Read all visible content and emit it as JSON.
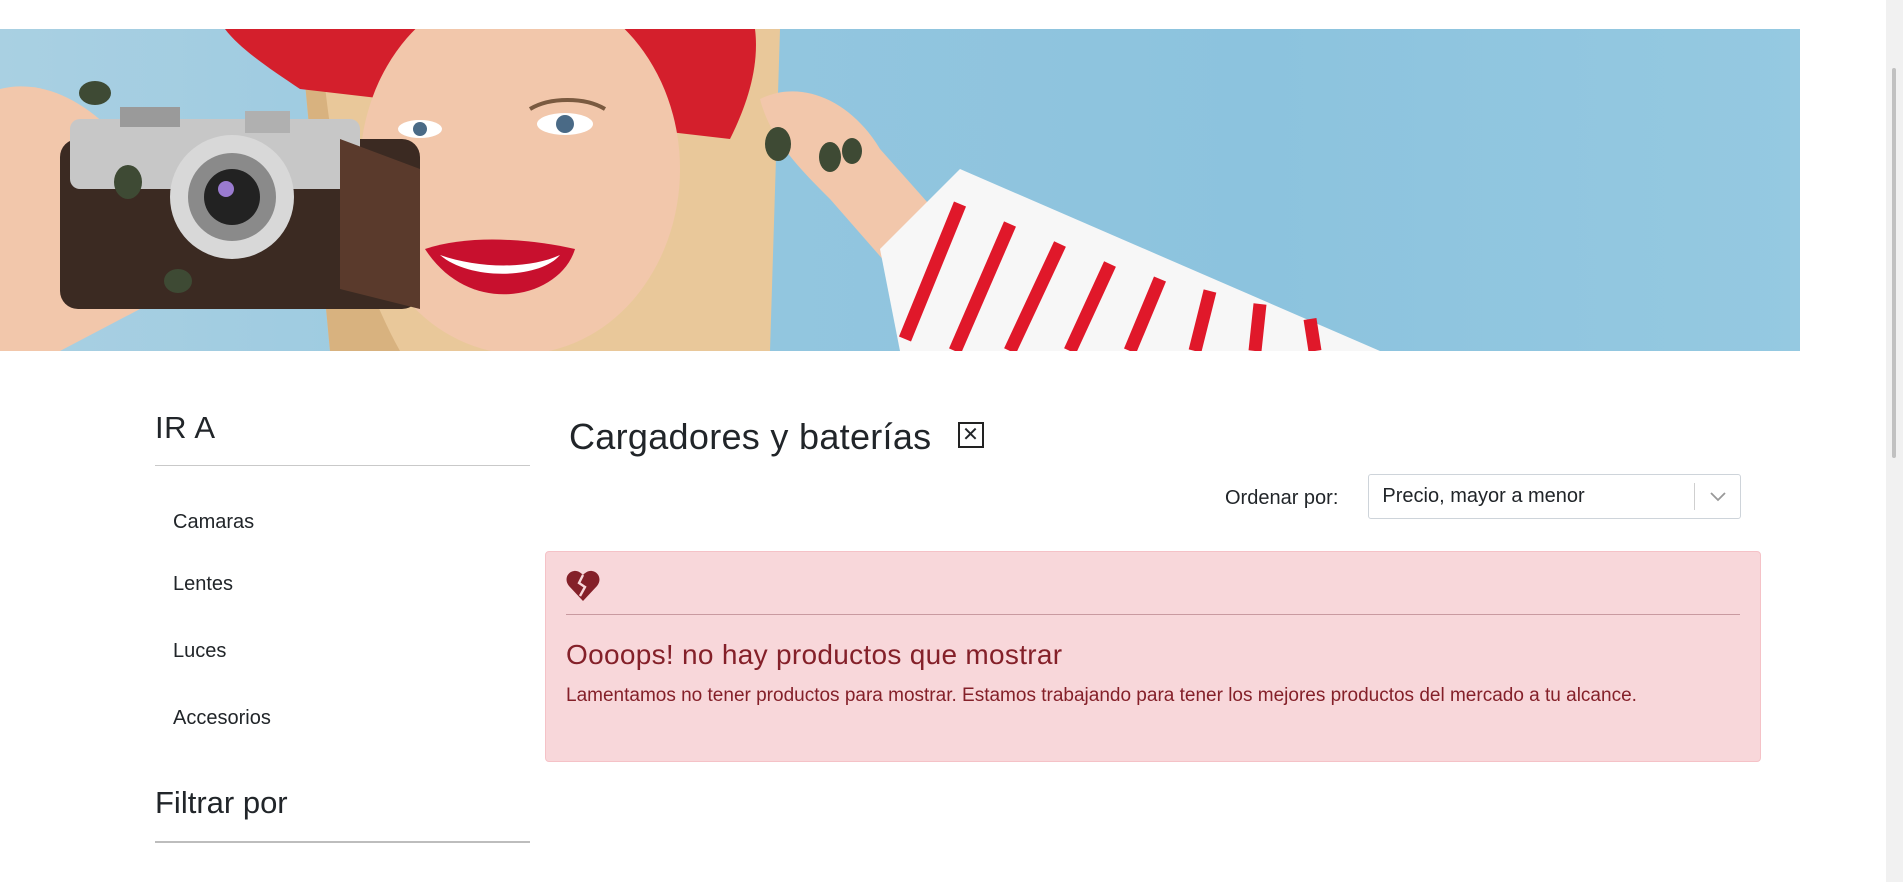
{
  "hero": {
    "alt": "banner-photo"
  },
  "sidebar": {
    "title": "IR A",
    "items": [
      {
        "label": "Camaras"
      },
      {
        "label": "Lentes"
      },
      {
        "label": "Luces"
      },
      {
        "label": "Accesorios"
      }
    ],
    "filter_title": "Filtrar por"
  },
  "main": {
    "title": "Cargadores y baterías",
    "clear_icon": "close-box-icon",
    "sort": {
      "label": "Ordenar por:",
      "selected": "Precio, mayor a menor"
    },
    "alert": {
      "icon": "broken-heart-icon",
      "heading": "Oooops! no hay productos que mostrar",
      "message": "Lamentamos no tener productos para mostrar. Estamos trabajando para tener los mejores productos del mercado a tu alcance."
    }
  },
  "colors": {
    "alert_bg": "#f8d7da",
    "alert_text": "#842029",
    "hero_sky": "#8cc3de"
  }
}
